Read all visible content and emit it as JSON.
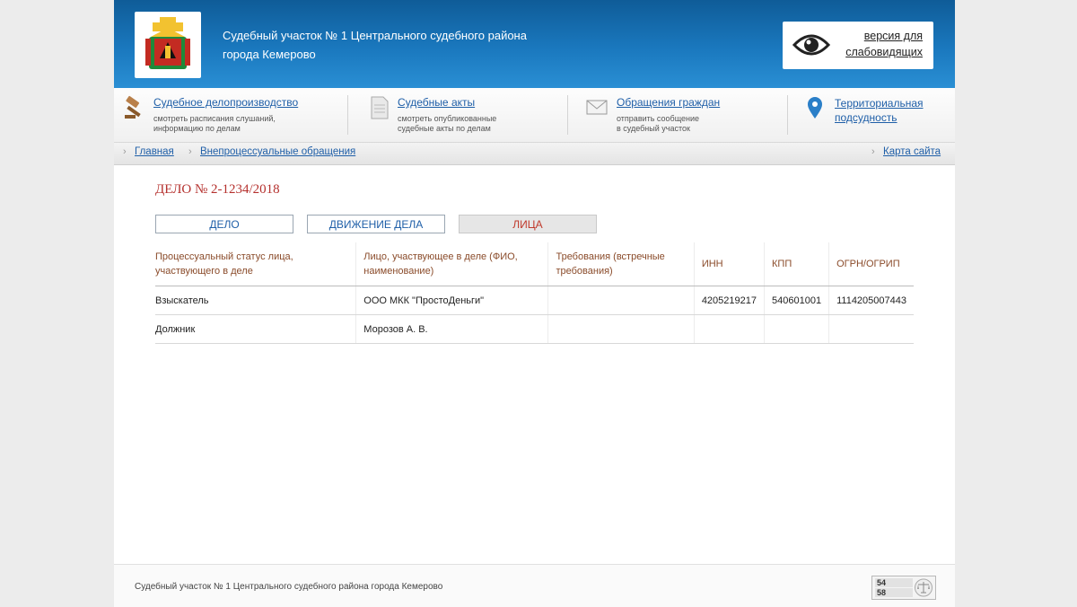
{
  "header": {
    "title_line1": "Судебный участок № 1 Центрального судебного района",
    "title_line2": "города Кемерово",
    "vision_line1": "версия для",
    "vision_line2": "слабовидящих"
  },
  "nav": {
    "items": [
      {
        "title": "Судебное делопроизводство",
        "desc1": "смотреть расписания слушаний,",
        "desc2": "информацию по делам",
        "icon": "gavel-icon"
      },
      {
        "title": "Судебные акты",
        "desc1": "смотреть опубликованные",
        "desc2": "судебные акты по делам",
        "icon": "document-icon"
      },
      {
        "title": "Обращения граждан",
        "desc1": "отправить сообщение",
        "desc2": "в судебный участок",
        "icon": "envelope-icon"
      },
      {
        "title_line1": "Территориальная",
        "title_line2": "подсудность",
        "icon": "map-pin-icon"
      }
    ]
  },
  "breadcrumb": {
    "home": "Главная",
    "section": "Внепроцессуальные обращения",
    "sitemap": "Карта сайта"
  },
  "case": {
    "title": "ДЕЛО № 2-1234/2018",
    "tabs": [
      "ДЕЛО",
      "ДВИЖЕНИЕ ДЕЛА",
      "ЛИЦА"
    ],
    "active_tab": "ЛИЦА"
  },
  "table": {
    "headers": [
      "Процессуальный статус лица, участвующего в деле",
      "Лицо, участвующее в деле (ФИО, наименование)",
      "Требования (встречные требования)",
      "ИНН",
      "КПП",
      "ОГРН/ОГРИП"
    ],
    "rows": [
      [
        "Взыскатель",
        "ООО МКК \"ПростоДеньги\"",
        "",
        "4205219217",
        "540601001",
        "1114205007443"
      ],
      [
        "Должник",
        "Морозов А. В.",
        "",
        "",
        "",
        ""
      ]
    ]
  },
  "footer": {
    "text": "Судебный участок № 1 Центрального судебного района города Кемерово",
    "counter_top": "54",
    "counter_bottom": "58"
  },
  "colors": {
    "header_blue": "#1a78be",
    "link_blue": "#1f5fa8",
    "case_red": "#b5312e",
    "header_text_brown": "#8a4b2a"
  }
}
